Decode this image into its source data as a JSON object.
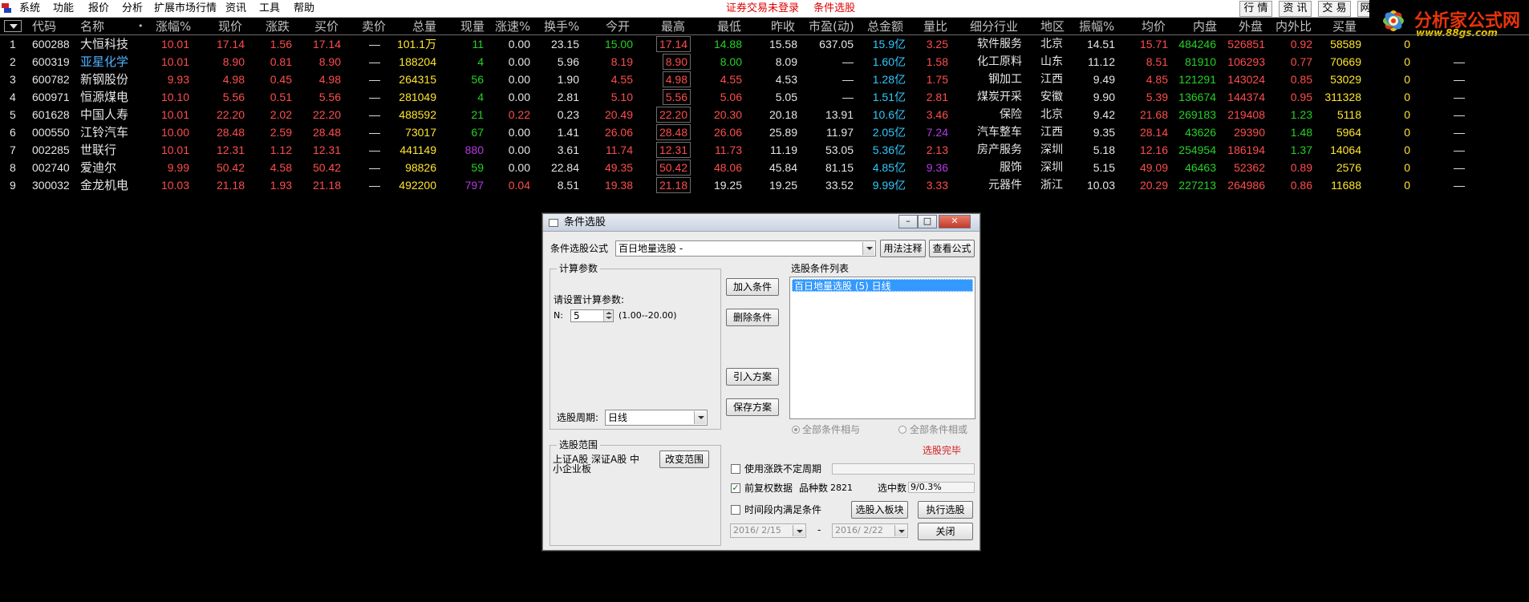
{
  "menu": {
    "items": [
      "系统",
      "功能",
      "报价",
      "分析",
      "扩展市场行情",
      "资讯",
      "工具",
      "帮助"
    ],
    "status": [
      "证券交易未登录",
      "条件选股"
    ],
    "right_buttons": [
      "行 情",
      "资 讯",
      "交 易",
      "网"
    ],
    "logo_text": "分析家公式网",
    "logo_url": "www.88gs.com"
  },
  "table": {
    "headers": [
      "代码",
      "名称",
      "•",
      "涨幅%",
      "现价",
      "涨跌",
      "买价",
      "卖价",
      "总量",
      "现量",
      "涨速%",
      "换手%",
      "今开",
      "最高",
      "最低",
      "昨收",
      "市盈(动)",
      "总金额",
      "量比",
      "细分行业",
      "地区",
      "振幅%",
      "均价",
      "内盘",
      "外盘",
      "内外比",
      "买量"
    ],
    "rows": [
      {
        "idx": "1",
        "code": "600288",
        "name": "大恒科技",
        "chg": "10.01",
        "price": "17.14",
        "diff": "1.56",
        "bid": "17.14",
        "ask": "—",
        "vol": "101.1万",
        "cur": "11",
        "spd": "0.00",
        "turn": "23.15",
        "open": "15.00",
        "high": "17.14",
        "low": "14.88",
        "close": "15.58",
        "pe": "637.05",
        "amt": "15.9亿",
        "vr": "3.25",
        "ind": "软件服务",
        "reg": "北京",
        "amp": "14.51",
        "avg": "15.71",
        "inner": "484246",
        "outer": "526851",
        "ratio": "0.92",
        "bidv": "58589",
        "x": "0",
        "y": ""
      },
      {
        "idx": "2",
        "code": "600319",
        "name": "亚星化学",
        "chg": "10.01",
        "price": "8.90",
        "diff": "0.81",
        "bid": "8.90",
        "ask": "—",
        "vol": "188204",
        "cur": "4",
        "spd": "0.00",
        "turn": "5.96",
        "open": "8.19",
        "high": "8.90",
        "low": "8.00",
        "close": "8.09",
        "pe": "—",
        "amt": "1.60亿",
        "vr": "1.58",
        "ind": "化工原料",
        "reg": "山东",
        "amp": "11.12",
        "avg": "8.51",
        "inner": "81910",
        "outer": "106293",
        "ratio": "0.77",
        "bidv": "70669",
        "x": "0",
        "y": "—"
      },
      {
        "idx": "3",
        "code": "600782",
        "name": "新钢股份",
        "chg": "9.93",
        "price": "4.98",
        "diff": "0.45",
        "bid": "4.98",
        "ask": "—",
        "vol": "264315",
        "cur": "56",
        "spd": "0.00",
        "turn": "1.90",
        "open": "4.55",
        "high": "4.98",
        "low": "4.55",
        "close": "4.53",
        "pe": "—",
        "amt": "1.28亿",
        "vr": "1.75",
        "ind": "钢加工",
        "reg": "江西",
        "amp": "9.49",
        "avg": "4.85",
        "inner": "121291",
        "outer": "143024",
        "ratio": "0.85",
        "bidv": "53029",
        "x": "0",
        "y": "—"
      },
      {
        "idx": "4",
        "code": "600971",
        "name": "恒源煤电",
        "chg": "10.10",
        "price": "5.56",
        "diff": "0.51",
        "bid": "5.56",
        "ask": "—",
        "vol": "281049",
        "cur": "4",
        "spd": "0.00",
        "turn": "2.81",
        "open": "5.10",
        "high": "5.56",
        "low": "5.06",
        "close": "5.05",
        "pe": "—",
        "amt": "1.51亿",
        "vr": "2.81",
        "ind": "煤炭开采",
        "reg": "安徽",
        "amp": "9.90",
        "avg": "5.39",
        "inner": "136674",
        "outer": "144374",
        "ratio": "0.95",
        "bidv": "311328",
        "x": "0",
        "y": "—"
      },
      {
        "idx": "5",
        "code": "601628",
        "name": "中国人寿",
        "chg": "10.01",
        "price": "22.20",
        "diff": "2.02",
        "bid": "22.20",
        "ask": "—",
        "vol": "488592",
        "cur": "21",
        "spd": "0.22",
        "turn": "0.23",
        "open": "20.49",
        "high": "22.20",
        "low": "20.30",
        "close": "20.18",
        "pe": "13.91",
        "amt": "10.6亿",
        "vr": "3.46",
        "ind": "保险",
        "reg": "北京",
        "amp": "9.42",
        "avg": "21.68",
        "inner": "269183",
        "outer": "219408",
        "ratio": "1.23",
        "bidv": "5118",
        "x": "0",
        "y": "—"
      },
      {
        "idx": "6",
        "code": "000550",
        "name": "江铃汽车",
        "chg": "10.00",
        "price": "28.48",
        "diff": "2.59",
        "bid": "28.48",
        "ask": "—",
        "vol": "73017",
        "cur": "67",
        "spd": "0.00",
        "turn": "1.41",
        "open": "26.06",
        "high": "28.48",
        "low": "26.06",
        "close": "25.89",
        "pe": "11.97",
        "amt": "2.05亿",
        "vr": "7.24",
        "ind": "汽车整车",
        "reg": "江西",
        "amp": "9.35",
        "avg": "28.14",
        "inner": "43626",
        "outer": "29390",
        "ratio": "1.48",
        "bidv": "5964",
        "x": "0",
        "y": "—"
      },
      {
        "idx": "7",
        "code": "002285",
        "name": "世联行",
        "chg": "10.01",
        "price": "12.31",
        "diff": "1.12",
        "bid": "12.31",
        "ask": "—",
        "vol": "441149",
        "cur": "880",
        "spd": "0.00",
        "turn": "3.61",
        "open": "11.74",
        "high": "12.31",
        "low": "11.73",
        "close": "11.19",
        "pe": "53.05",
        "amt": "5.36亿",
        "vr": "2.13",
        "ind": "房产服务",
        "reg": "深圳",
        "amp": "5.18",
        "avg": "12.16",
        "inner": "254954",
        "outer": "186194",
        "ratio": "1.37",
        "bidv": "14064",
        "x": "0",
        "y": "—"
      },
      {
        "idx": "8",
        "code": "002740",
        "name": "爱迪尔",
        "chg": "9.99",
        "price": "50.42",
        "diff": "4.58",
        "bid": "50.42",
        "ask": "—",
        "vol": "98826",
        "cur": "59",
        "spd": "0.00",
        "turn": "22.84",
        "open": "49.35",
        "high": "50.42",
        "low": "48.06",
        "close": "45.84",
        "pe": "81.15",
        "amt": "4.85亿",
        "vr": "9.36",
        "ind": "服饰",
        "reg": "深圳",
        "amp": "5.15",
        "avg": "49.09",
        "inner": "46463",
        "outer": "52362",
        "ratio": "0.89",
        "bidv": "2576",
        "x": "0",
        "y": "—"
      },
      {
        "idx": "9",
        "code": "300032",
        "name": "金龙机电",
        "chg": "10.03",
        "price": "21.18",
        "diff": "1.93",
        "bid": "21.18",
        "ask": "—",
        "vol": "492200",
        "cur": "797",
        "spd": "0.04",
        "turn": "8.51",
        "open": "19.38",
        "high": "21.18",
        "low": "19.25",
        "close": "19.25",
        "pe": "33.52",
        "amt": "9.99亿",
        "vr": "3.33",
        "ind": "元器件",
        "reg": "浙江",
        "amp": "10.03",
        "avg": "20.29",
        "inner": "227213",
        "outer": "264986",
        "ratio": "0.86",
        "bidv": "11688",
        "x": "0",
        "y": "—"
      }
    ]
  },
  "dialog": {
    "title": "条件选股",
    "formula_label": "条件选股公式",
    "formula_value": "百日地量选股 -",
    "usage_btn": "用法注释",
    "view_btn": "查看公式",
    "params_group": "计算参数",
    "params_prompt": "请设置计算参数:",
    "param_name": "N:",
    "param_value": "5",
    "param_range": "(1.00--20.00)",
    "add_btn": "加入条件",
    "delete_btn": "删除条件",
    "import_btn": "引入方案",
    "save_btn": "保存方案",
    "list_label": "选股条件列表",
    "list_item": "百日地量选股 (5) 日线",
    "radio_and": "全部条件相与",
    "radio_or": "全部条件相或",
    "period_label": "选股周期:",
    "period_value": "日线",
    "done_text": "选股完毕",
    "range_group": "选股范围",
    "range_text": "上证A股 深证A股 中小企业板",
    "change_range_btn": "改变范围",
    "uncertain_period": "使用涨跌不定周期",
    "pre_adjust": "前复权数据",
    "count_label": "品种数",
    "count_value": "2821",
    "selected_label": "选中数",
    "selected_value": "9/0.3%",
    "time_cond": "时间段内满足条件",
    "to_block_btn": "选股入板块",
    "execute_btn": "执行选股",
    "date_from": "2016/ 2/15",
    "date_sep": "-",
    "date_to": "2016/ 2/22",
    "close_btn": "关闭"
  }
}
